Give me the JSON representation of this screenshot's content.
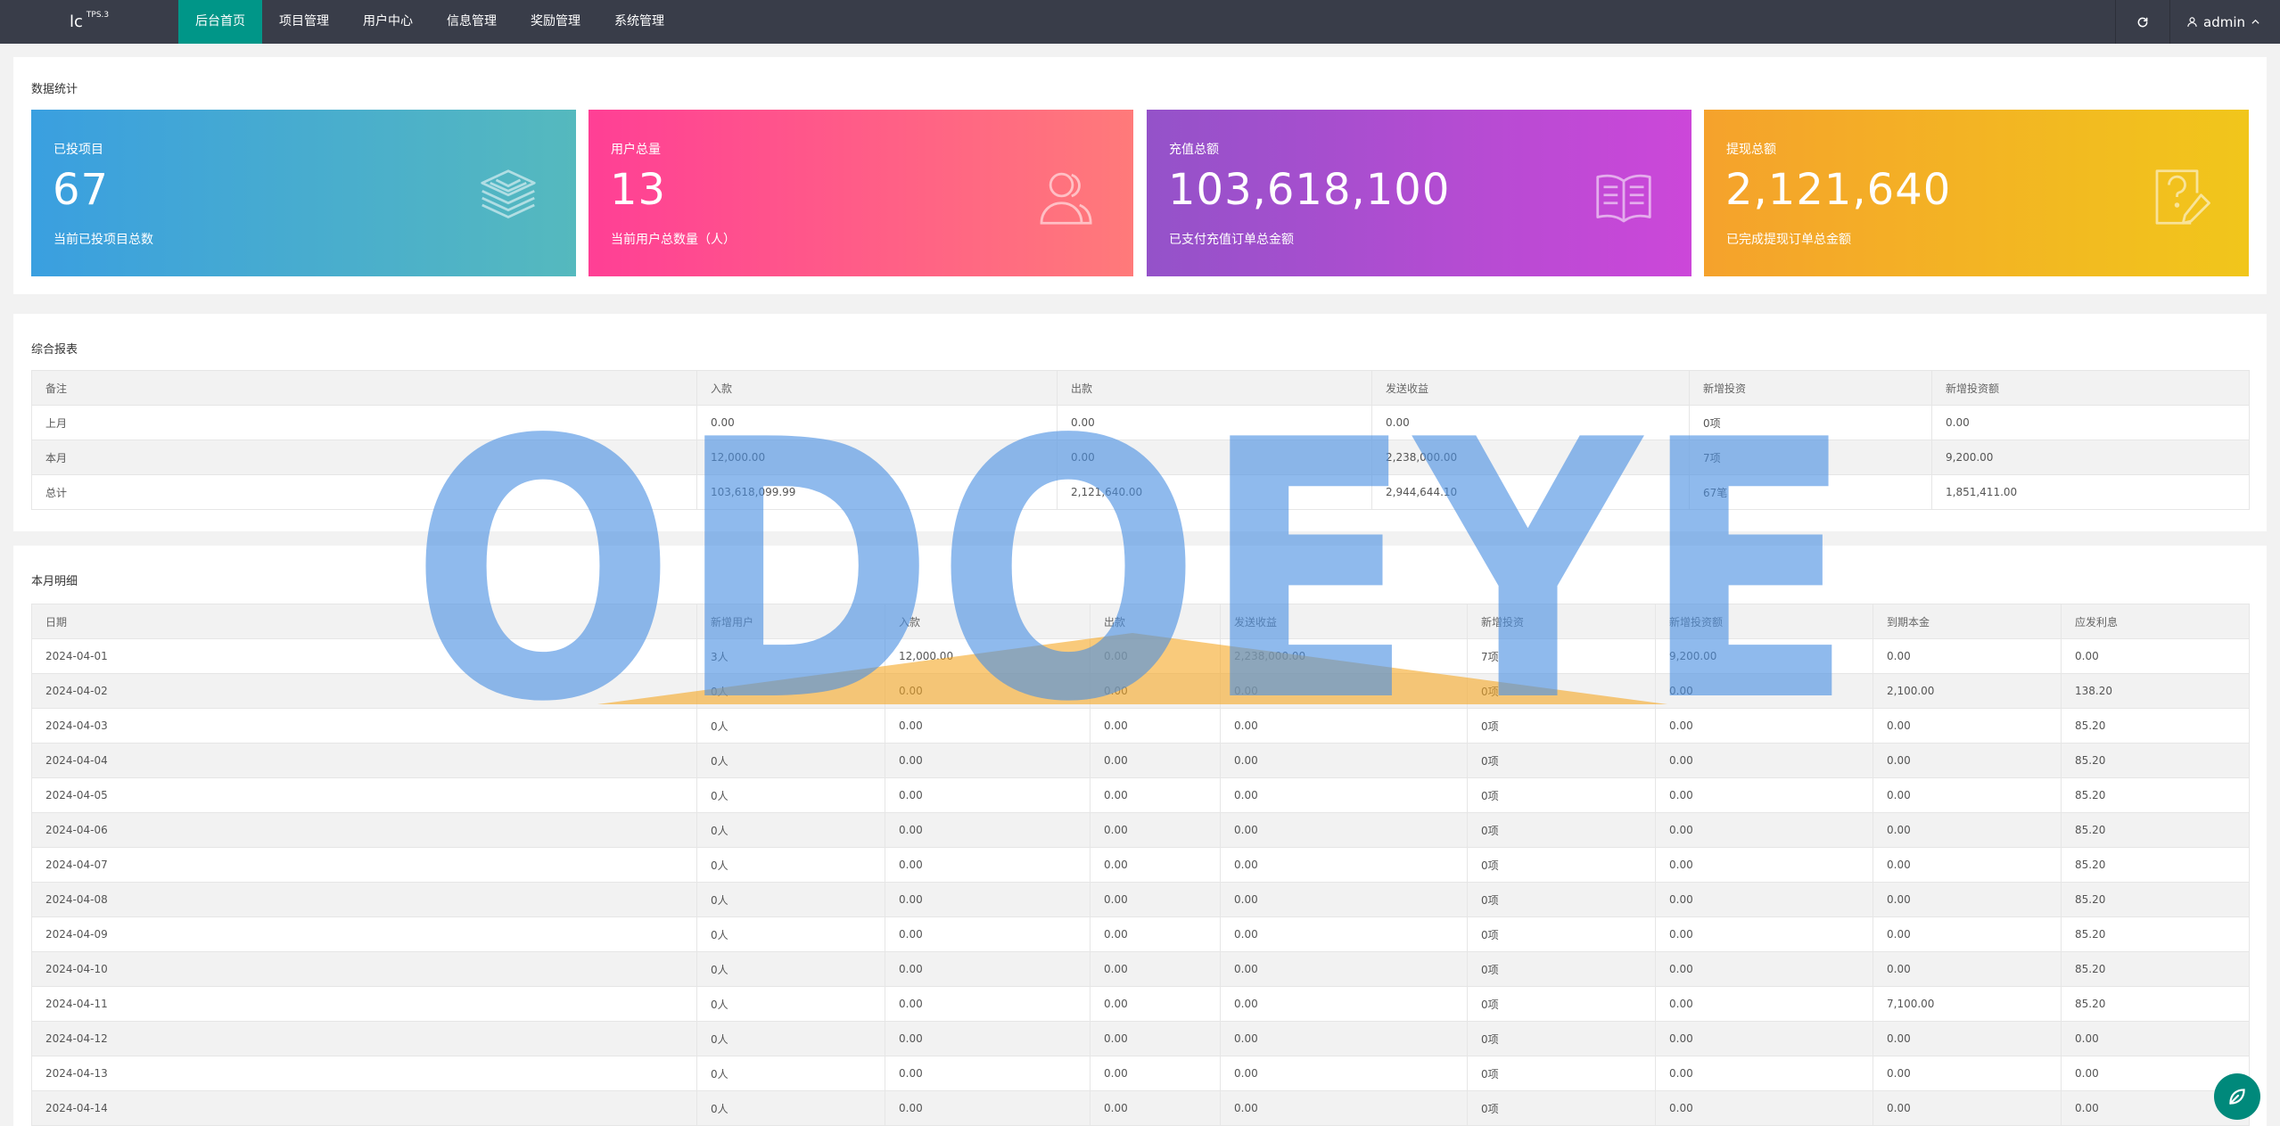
{
  "header": {
    "logo": "lc",
    "logo_sup": "TPS.3",
    "nav": [
      "后台首页",
      "项目管理",
      "用户中心",
      "信息管理",
      "奖励管理",
      "系统管理"
    ],
    "active_nav": 0,
    "user": "admin",
    "icons": {
      "refresh": "refresh-icon",
      "user": "user-icon",
      "caret": "chevron-up-icon"
    }
  },
  "stats": {
    "title": "数据统计",
    "cards": [
      {
        "label": "已投项目",
        "value": "67",
        "desc": "当前已投项目总数",
        "icon": "layers-icon",
        "gradient": [
          "#3a9fe0",
          "#55b9be"
        ]
      },
      {
        "label": "用户总量",
        "value": "13",
        "desc": "当前用户总数量（人）",
        "icon": "users-icon",
        "gradient": [
          "#ff3f95",
          "#ff7a7a"
        ]
      },
      {
        "label": "充值总额",
        "value": "103,618,100",
        "desc": "已支付充值订单总金额",
        "icon": "book-icon",
        "gradient": [
          "#9452c9",
          "#cc47d9"
        ]
      },
      {
        "label": "提现总额",
        "value": "2,121,640",
        "desc": "已完成提现订单总金额",
        "icon": "help-edit-icon",
        "gradient": [
          "#f5a22c",
          "#f1c61b"
        ]
      }
    ]
  },
  "report": {
    "title": "综合报表",
    "columns": [
      "备注",
      "入款",
      "出款",
      "发送收益",
      "新增投资",
      "新增投资额"
    ],
    "rows": [
      [
        "上月",
        "0.00",
        "0.00",
        "0.00",
        "0项",
        "0.00"
      ],
      [
        "本月",
        "12,000.00",
        "0.00",
        "2,238,000.00",
        "7项",
        "9,200.00"
      ],
      [
        "总计",
        "103,618,099.99",
        "2,121,640.00",
        "2,944,644.10",
        "67笔",
        "1,851,411.00"
      ]
    ]
  },
  "monthly": {
    "title": "本月明细",
    "columns": [
      "日期",
      "新增用户",
      "入款",
      "出款",
      "发送收益",
      "新增投资",
      "新增投资额",
      "到期本金",
      "应发利息"
    ],
    "rows": [
      [
        "2024-04-01",
        "3人",
        "12,000.00",
        "0.00",
        "2,238,000.00",
        "7项",
        "9,200.00",
        "0.00",
        "0.00"
      ],
      [
        "2024-04-02",
        "0人",
        "0.00",
        "0.00",
        "0.00",
        "0项",
        "0.00",
        "2,100.00",
        "138.20"
      ],
      [
        "2024-04-03",
        "0人",
        "0.00",
        "0.00",
        "0.00",
        "0项",
        "0.00",
        "0.00",
        "85.20"
      ],
      [
        "2024-04-04",
        "0人",
        "0.00",
        "0.00",
        "0.00",
        "0项",
        "0.00",
        "0.00",
        "85.20"
      ],
      [
        "2024-04-05",
        "0人",
        "0.00",
        "0.00",
        "0.00",
        "0项",
        "0.00",
        "0.00",
        "85.20"
      ],
      [
        "2024-04-06",
        "0人",
        "0.00",
        "0.00",
        "0.00",
        "0项",
        "0.00",
        "0.00",
        "85.20"
      ],
      [
        "2024-04-07",
        "0人",
        "0.00",
        "0.00",
        "0.00",
        "0项",
        "0.00",
        "0.00",
        "85.20"
      ],
      [
        "2024-04-08",
        "0人",
        "0.00",
        "0.00",
        "0.00",
        "0项",
        "0.00",
        "0.00",
        "85.20"
      ],
      [
        "2024-04-09",
        "0人",
        "0.00",
        "0.00",
        "0.00",
        "0项",
        "0.00",
        "0.00",
        "85.20"
      ],
      [
        "2024-04-10",
        "0人",
        "0.00",
        "0.00",
        "0.00",
        "0项",
        "0.00",
        "0.00",
        "85.20"
      ],
      [
        "2024-04-11",
        "0人",
        "0.00",
        "0.00",
        "0.00",
        "0项",
        "0.00",
        "7,100.00",
        "85.20"
      ],
      [
        "2024-04-12",
        "0人",
        "0.00",
        "0.00",
        "0.00",
        "0项",
        "0.00",
        "0.00",
        "0.00"
      ],
      [
        "2024-04-13",
        "0人",
        "0.00",
        "0.00",
        "0.00",
        "0项",
        "0.00",
        "0.00",
        "0.00"
      ],
      [
        "2024-04-14",
        "0人",
        "0.00",
        "0.00",
        "0.00",
        "0项",
        "0.00",
        "0.00",
        "0.00"
      ]
    ]
  },
  "watermark": {
    "text": "ODOEYE",
    "color": "#4a90e2",
    "accent": "#f5a623"
  },
  "float_button": {
    "icon": "leaf-icon",
    "color": "#00897b"
  }
}
